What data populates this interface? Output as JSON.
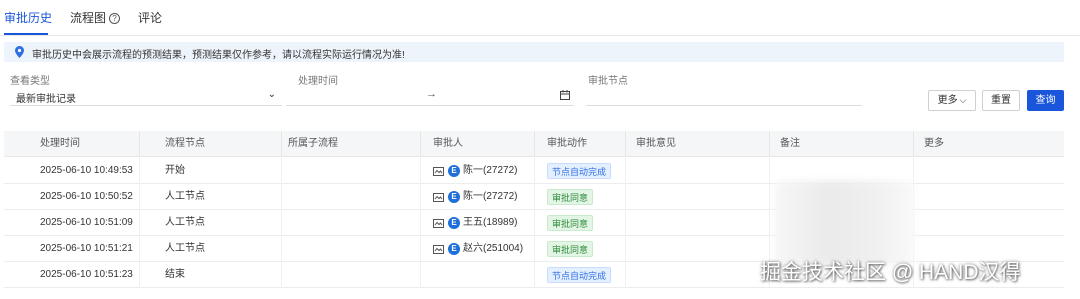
{
  "tabs": [
    {
      "label": "审批历史"
    },
    {
      "label": "流程图"
    },
    {
      "label": "评论"
    }
  ],
  "banner": {
    "text": "审批历史中会展示流程的预测结果，预测结果仅作参考，请以流程实际运行情况为准!"
  },
  "filters": {
    "view_type_label": "查看类型",
    "view_type_value": "最新审批记录",
    "time_label": "处理时间",
    "time_arrow": "→",
    "node_label": "审批节点"
  },
  "buttons": {
    "more": "更多",
    "reset": "重置",
    "query": "查询"
  },
  "table": {
    "headers": [
      "处理时间",
      "流程节点",
      "所属子流程",
      "审批人",
      "审批动作",
      "审批意见",
      "备注",
      "更多"
    ],
    "rows": [
      {
        "time": "2025-06-10 10:49:53",
        "node": "开始",
        "approver": "陈一(27272)",
        "action": "节点自动完成",
        "action_color": "blue"
      },
      {
        "time": "2025-06-10 10:50:52",
        "node": "人工节点",
        "approver": "陈一(27272)",
        "action": "审批同意",
        "action_color": "green"
      },
      {
        "time": "2025-06-10 10:51:09",
        "node": "人工节点",
        "approver": "王五(18989)",
        "action": "审批同意",
        "action_color": "green"
      },
      {
        "time": "2025-06-10 10:51:21",
        "node": "人工节点",
        "approver": "赵六(251004)",
        "action": "审批同意",
        "action_color": "green"
      },
      {
        "time": "2025-06-10 10:51:23",
        "node": "结束",
        "approver": "",
        "action": "节点自动完成",
        "action_color": "blue"
      }
    ]
  },
  "avatar_letter": "E",
  "watermark": "掘金技术社区 @ HAND汉得",
  "colors": {
    "accent": "#1a56db",
    "tag_blue": "#2f6fe4",
    "tag_green": "#2e8b3c"
  }
}
